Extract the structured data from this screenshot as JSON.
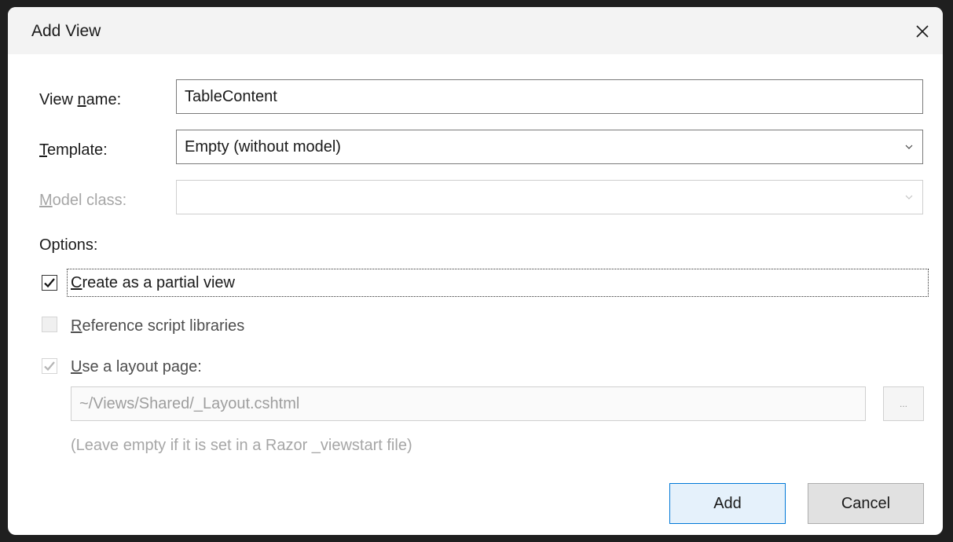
{
  "dialog": {
    "title": "Add View",
    "close_icon": "close-icon"
  },
  "view_name": {
    "label_pre": "View ",
    "label_accel": "n",
    "label_post": "ame:",
    "value": "TableContent"
  },
  "template": {
    "label_accel": "T",
    "label_post": "emplate:",
    "value": "Empty (without model)"
  },
  "model_class": {
    "label_accel": "M",
    "label_post": "odel class:",
    "value": ""
  },
  "options": {
    "label": "Options:",
    "partial_view": {
      "accel": "C",
      "rest": "reate as a partial view",
      "checked": true
    },
    "reference_scripts": {
      "accel": "R",
      "rest": "eference script libraries",
      "checked": false
    },
    "use_layout": {
      "accel": "U",
      "rest": "se a layout page:",
      "checked": true
    }
  },
  "layout_path": {
    "value": "~/Views/Shared/_Layout.cshtml",
    "browse_label": "...",
    "hint": "(Leave empty if it is set in a Razor _viewstart file)"
  },
  "buttons": {
    "add": "Add",
    "cancel": "Cancel"
  }
}
